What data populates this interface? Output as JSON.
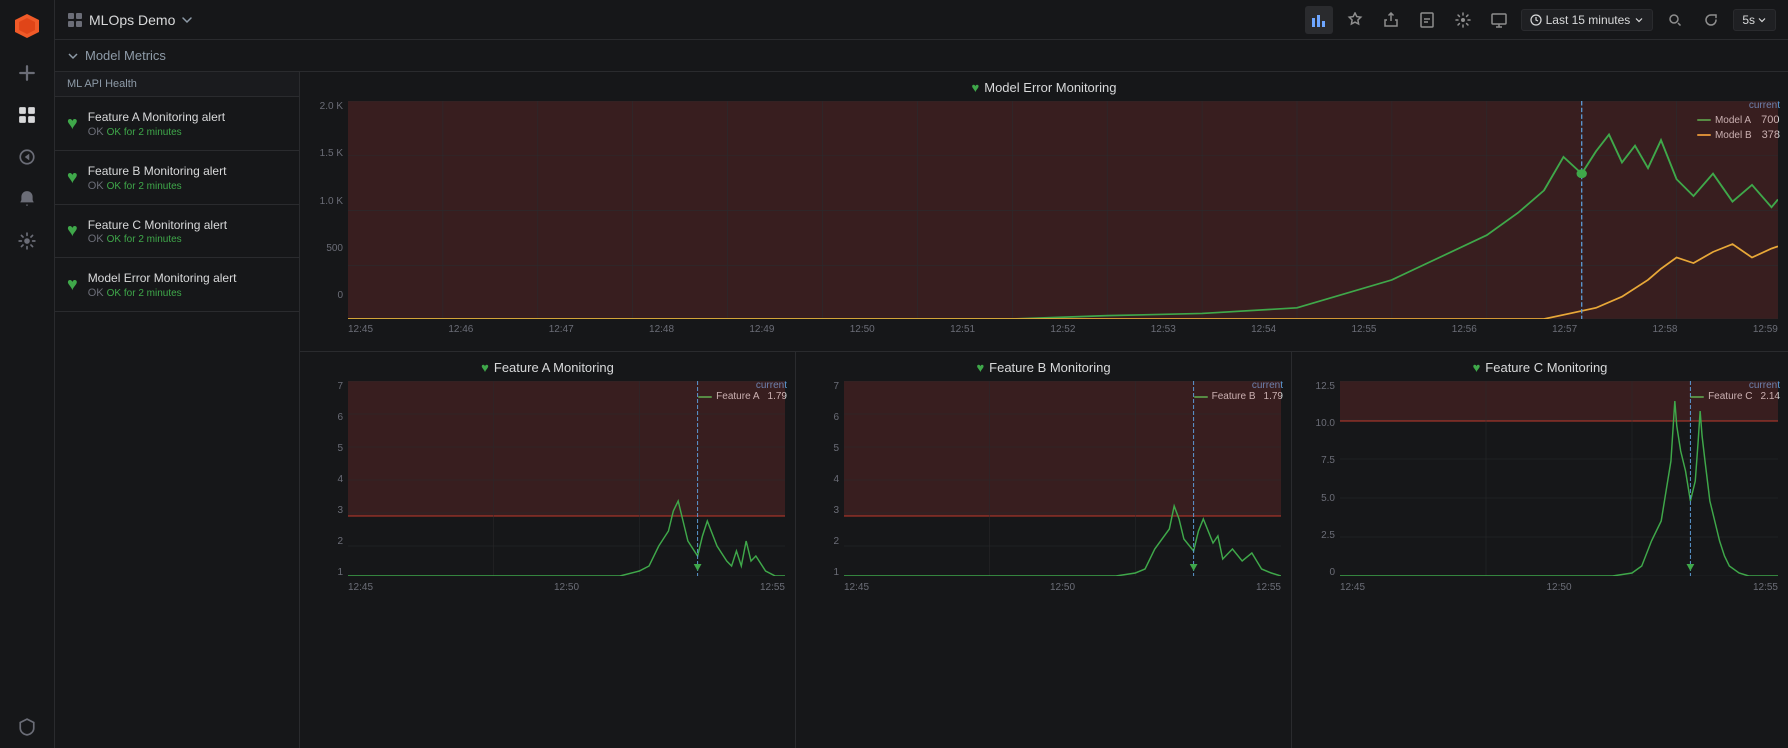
{
  "app": {
    "title": "MLOps Demo",
    "logo_icon": "grid-squares-icon"
  },
  "topbar": {
    "title": "MLOps Demo",
    "time_label": "Last 15 minutes",
    "refresh_label": "5s",
    "icons": [
      "bar-chart-icon",
      "star-icon",
      "share-icon",
      "bookmark-icon",
      "settings-icon",
      "tv-icon"
    ]
  },
  "section": {
    "title": "Model Metrics",
    "chevron": "chevron-down-icon"
  },
  "sidebar_icons": [
    "plus-icon",
    "grid-icon",
    "compass-icon",
    "bell-icon",
    "gear-icon",
    "shield-icon"
  ],
  "alert_panel": {
    "header": "ML API Health",
    "items": [
      {
        "name": "Feature A Monitoring alert",
        "status": "OK for 2 minutes"
      },
      {
        "name": "Feature B Monitoring alert",
        "status": "OK for 2 minutes"
      },
      {
        "name": "Feature C Monitoring alert",
        "status": "OK for 2 minutes"
      },
      {
        "name": "Model Error Monitoring alert",
        "status": "OK for 2 minutes"
      }
    ]
  },
  "charts": {
    "main": {
      "title": "Model Error Monitoring",
      "y_labels": [
        "2.0 K",
        "1.5 K",
        "1.0 K",
        "500",
        "0"
      ],
      "x_labels": [
        "12:45",
        "12:46",
        "12:47",
        "12:48",
        "12:49",
        "12:50",
        "12:51",
        "12:52",
        "12:53",
        "12:54",
        "12:55",
        "12:56",
        "12:57",
        "12:58",
        "12:59"
      ],
      "current_label": "current",
      "legend": [
        {
          "name": "Model A",
          "color": "#3fa84a",
          "value": "700"
        },
        {
          "name": "Model B",
          "color": "#e8a838",
          "value": "378"
        }
      ]
    },
    "feature_a": {
      "title": "Feature A Monitoring",
      "y_labels": [
        "7",
        "6",
        "5",
        "4",
        "3",
        "2",
        "1"
      ],
      "x_labels": [
        "12:45",
        "12:50",
        "12:55"
      ],
      "current_label": "current",
      "legend": [
        {
          "name": "Feature A",
          "color": "#3fa84a",
          "value": "1.79"
        }
      ]
    },
    "feature_b": {
      "title": "Feature B Monitoring",
      "y_labels": [
        "7",
        "6",
        "5",
        "4",
        "3",
        "2",
        "1"
      ],
      "x_labels": [
        "12:45",
        "12:50",
        "12:55"
      ],
      "current_label": "current",
      "legend": [
        {
          "name": "Feature B",
          "color": "#3fa84a",
          "value": "1.79"
        }
      ]
    },
    "feature_c": {
      "title": "Feature C Monitoring",
      "y_labels": [
        "12.5",
        "10.0",
        "7.5",
        "5.0",
        "2.5",
        "0"
      ],
      "x_labels": [
        "12:45",
        "12:50",
        "12:55"
      ],
      "current_label": "current",
      "legend": [
        {
          "name": "Feature C",
          "color": "#3fa84a",
          "value": "2.14"
        }
      ]
    }
  }
}
